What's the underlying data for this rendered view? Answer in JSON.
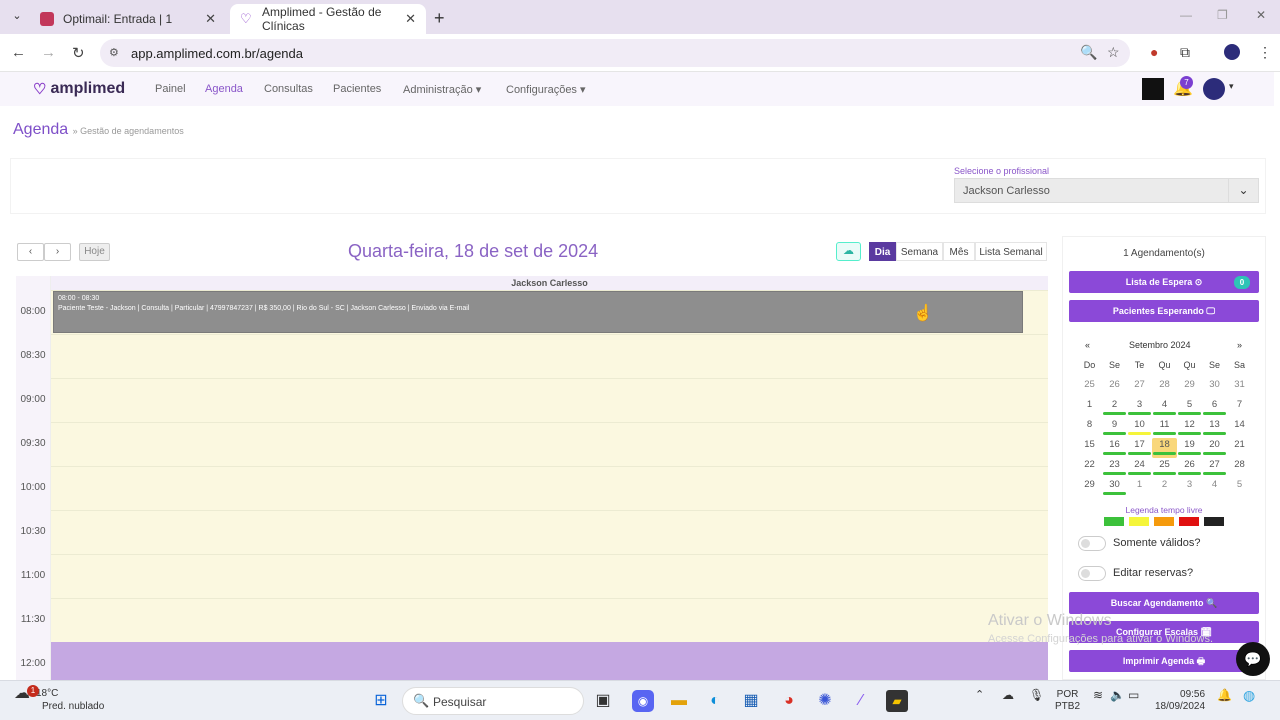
{
  "browser": {
    "tabs": [
      {
        "title": "Optimail: Entrada | 1"
      },
      {
        "title": "Amplimed - Gestão de Clínicas"
      }
    ],
    "url": "app.amplimed.com.br/agenda",
    "ext_badge": ""
  },
  "app": {
    "logo": "amplimed",
    "nav": [
      "Painel",
      "Agenda",
      "Consultas",
      "Pacientes",
      "Administração",
      "Configurações"
    ],
    "notif_count": "7"
  },
  "page": {
    "title": "Agenda",
    "subtitle": "» Gestão de agendamentos",
    "professional_label": "Selecione o profissional",
    "professional": "Jackson Carlesso"
  },
  "calendar": {
    "today_btn": "Hoje",
    "date_title": "Quarta-feira, 18 de set de 2024",
    "views": [
      "Dia",
      "Semana",
      "Mês",
      "Lista Semanal"
    ],
    "resource": "Jackson Carlesso",
    "times": [
      "08:00",
      "08:30",
      "09:00",
      "09:30",
      "10:00",
      "10:30",
      "11:00",
      "11:30",
      "12:00"
    ],
    "event": {
      "time": "08:00 - 08:30",
      "text": "Paciente Teste - Jackson | Consulta | Particular | 47997847237 | R$ 350,00 | Rio do Sul - SC | Jackson Carlesso | Enviado via E-mail"
    }
  },
  "side": {
    "count": "1 Agendamento(s)",
    "buttons": {
      "waitlist": "Lista de Espera ⊙",
      "waitlist_count": "0",
      "waiting": "Pacientes Esperando 🖵",
      "search": "Buscar Agendamento 🔍",
      "scales": "Configurar Escalas 🗓",
      "print": "Imprimir Agenda 🖶"
    },
    "month_title": "Setembro 2024",
    "prev": "«",
    "next": "»",
    "weekdays": [
      "Do",
      "Se",
      "Te",
      "Qu",
      "Qu",
      "Se",
      "Sa"
    ],
    "weeks": [
      [
        "25",
        "26",
        "27",
        "28",
        "29",
        "30",
        "31"
      ],
      [
        "1",
        "2",
        "3",
        "4",
        "5",
        "6",
        "7"
      ],
      [
        "8",
        "9",
        "10",
        "11",
        "12",
        "13",
        "14"
      ],
      [
        "15",
        "16",
        "17",
        "18",
        "19",
        "20",
        "21"
      ],
      [
        "22",
        "23",
        "24",
        "25",
        "26",
        "27",
        "28"
      ],
      [
        "29",
        "30",
        "1",
        "2",
        "3",
        "4",
        "5"
      ]
    ],
    "legend_label": "Legenda tempo livre",
    "legend_colors": [
      "#3cc13b",
      "#f5f53a",
      "#f59a0c",
      "#e01010",
      "#222222"
    ],
    "toggle1": "Somente válidos?",
    "toggle2": "Editar reservas?",
    "watermark_line1": "Ativar o Windows",
    "watermark_line2": "Acesse Configurações para ativar o Windows."
  },
  "taskbar": {
    "temp": "18°C",
    "weather": "Pred. nublado",
    "weather_badge": "1",
    "search": "Pesquisar",
    "lang1": "POR",
    "lang2": "PTB2",
    "time": "09:56",
    "date": "18/09/2024"
  }
}
